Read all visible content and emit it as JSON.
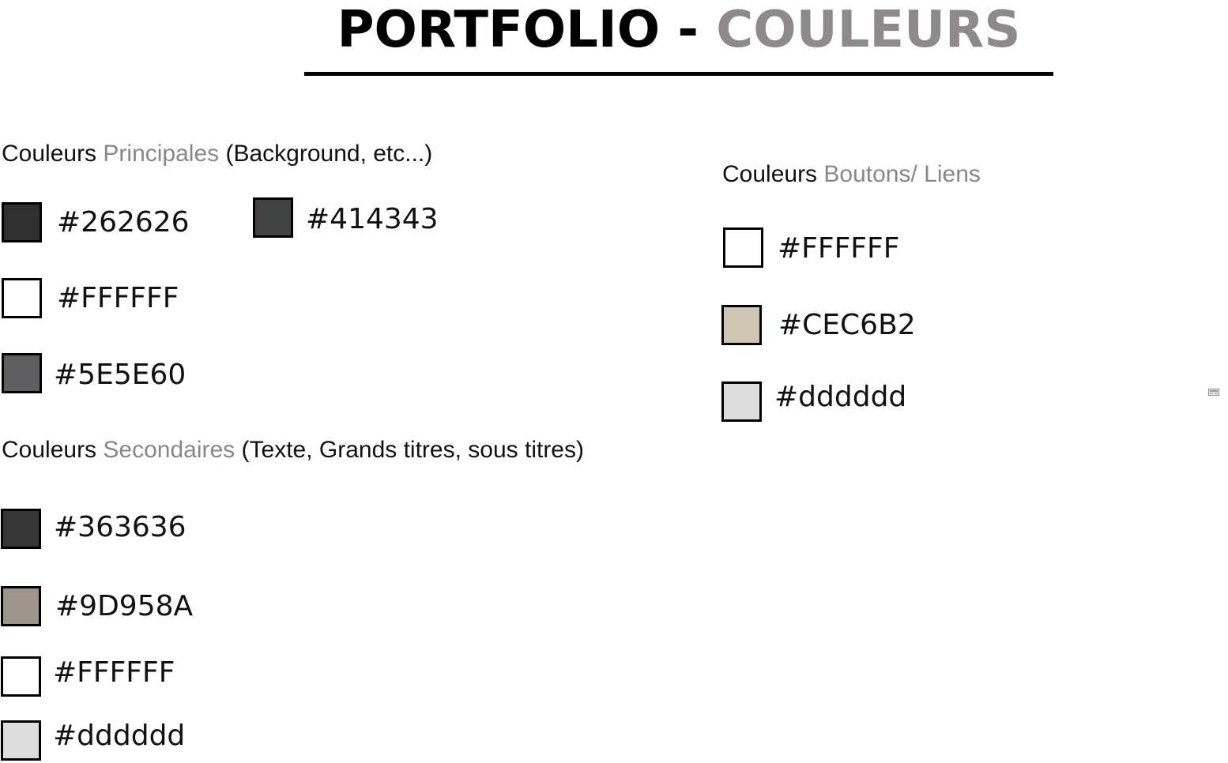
{
  "title": {
    "part1": "PORTFOLIO - ",
    "part2": "COULEURS",
    "color_part1": "#000000",
    "color_part2": "#8e8a8a"
  },
  "principales": {
    "heading_prefix": "Couleurs ",
    "heading_accent": "Principales",
    "heading_suffix": " (Background, etc...)",
    "colors": [
      {
        "hex": "#262626",
        "swatch": "#2f2f2f"
      },
      {
        "hex": "#414343",
        "swatch": "#414343"
      },
      {
        "hex": "#FFFFFF",
        "swatch": "#ffffff"
      },
      {
        "hex": "#5E5E60",
        "swatch": "#5e5e60"
      }
    ]
  },
  "secondaires": {
    "heading_prefix": "Couleurs ",
    "heading_accent": "Secondaires",
    "heading_suffix": " (Texte, Grands titres, sous titres)",
    "colors": [
      {
        "hex": "#363636",
        "swatch": "#363636"
      },
      {
        "hex": "#9D958A",
        "swatch": "#9d958a"
      },
      {
        "hex": "#FFFFFF",
        "swatch": "#ffffff"
      },
      {
        "hex": "#dddddd",
        "swatch": "#dddddd"
      }
    ]
  },
  "boutons": {
    "heading_prefix": "Couleurs ",
    "heading_accent": "Boutons/ Liens",
    "colors": [
      {
        "hex": "#FFFFFF",
        "swatch": "#ffffff"
      },
      {
        "hex": "#CEC6B2",
        "swatch": "#cec6b2"
      },
      {
        "hex": "#dddddd",
        "swatch": "#dddddd"
      }
    ]
  },
  "icons": {
    "corner": "small-image-icon"
  }
}
